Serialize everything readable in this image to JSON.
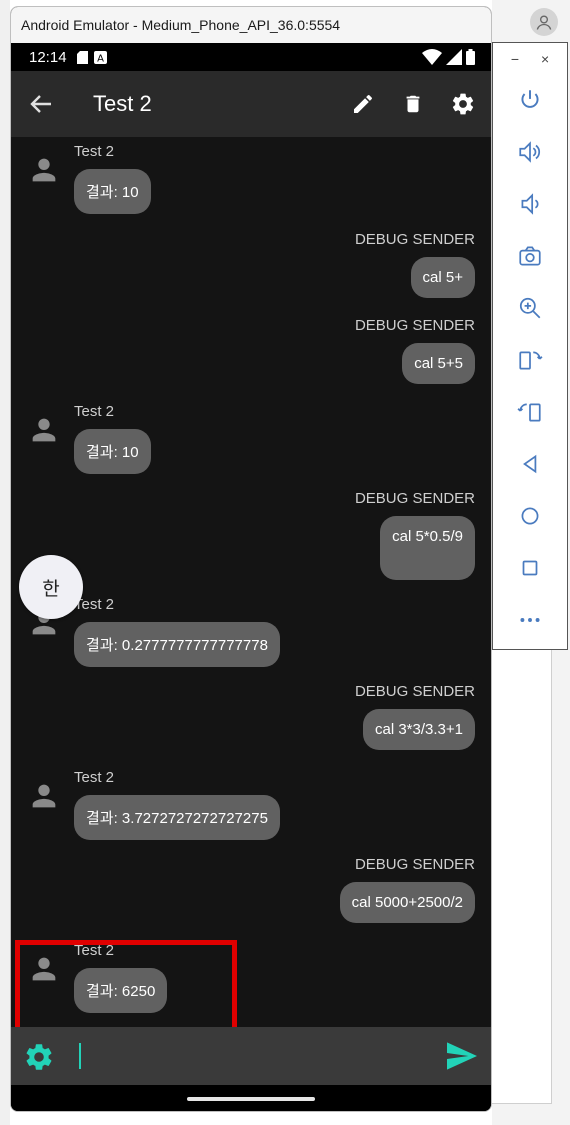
{
  "window": {
    "title": "Android Emulator - Medium_Phone_API_36.0:5554"
  },
  "status_bar": {
    "time": "12:14"
  },
  "app_bar": {
    "title": "Test 2"
  },
  "messages": [
    {
      "direction": "in",
      "sender": "Test 2",
      "text": "결과: 10"
    },
    {
      "direction": "out",
      "sender": "DEBUG SENDER",
      "text": "cal 5+"
    },
    {
      "direction": "out",
      "sender": "DEBUG SENDER",
      "text": "cal 5+5"
    },
    {
      "direction": "in",
      "sender": "Test 2",
      "text": "결과: 10"
    },
    {
      "direction": "out",
      "sender": "DEBUG SENDER",
      "text": "cal 5*0.5/9"
    },
    {
      "direction": "in",
      "sender": "Test 2",
      "text": "결과: 0.2777777777777778"
    },
    {
      "direction": "out",
      "sender": "DEBUG SENDER",
      "text": "cal 3*3/3.3+1"
    },
    {
      "direction": "in",
      "sender": "Test 2",
      "text": "결과: 3.7272727272727275"
    },
    {
      "direction": "out",
      "sender": "DEBUG SENDER",
      "text": "cal 5000+2500/2"
    },
    {
      "direction": "in",
      "sender": "Test 2",
      "text": "결과: 6250"
    }
  ],
  "ime_indicator": {
    "label": "한"
  },
  "toolbar": {
    "minimize": "−",
    "close": "×",
    "tools": [
      "power-icon",
      "volume-up-icon",
      "volume-down-icon",
      "camera-icon",
      "zoom-icon",
      "rotate-left-icon",
      "rotate-right-icon",
      "back-icon",
      "home-icon",
      "overview-icon",
      "more-icon"
    ]
  },
  "colors": {
    "accent": "#22d3b8",
    "bubble": "#616161",
    "background": "#141414",
    "app_bar": "#2a2a2a",
    "highlight": "#e00000"
  }
}
